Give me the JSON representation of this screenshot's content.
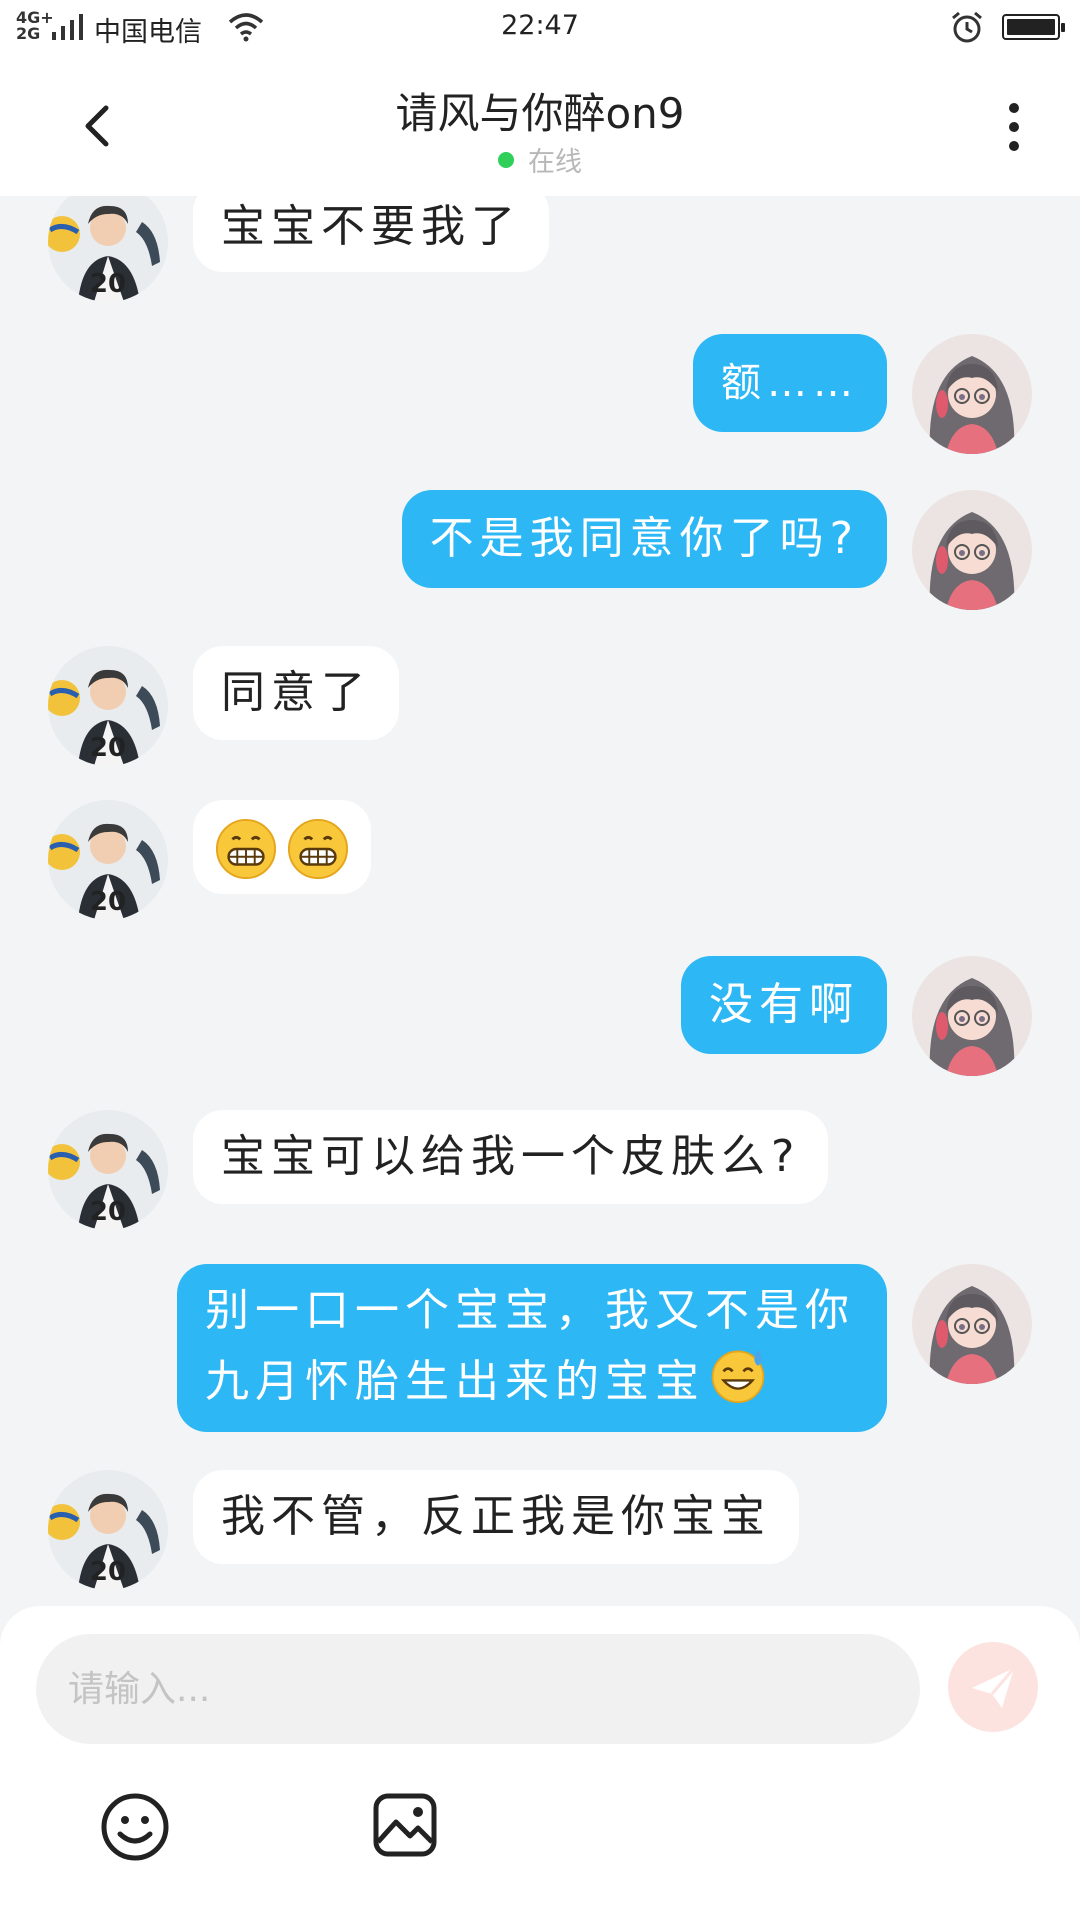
{
  "status_bar": {
    "signal_top": "4G+",
    "signal_bottom": "2G",
    "carrier": "中国电信",
    "time": "22:47"
  },
  "header": {
    "title": "请风与你醉on9",
    "status": "在线"
  },
  "messages": [
    {
      "side": "in",
      "text": "宝宝不要我了"
    },
    {
      "side": "out",
      "text": "额……"
    },
    {
      "side": "out",
      "text": "不是我同意你了吗?"
    },
    {
      "side": "in",
      "text": "同意了"
    },
    {
      "side": "in",
      "emoji": [
        "grinning-face",
        "grinning-face"
      ]
    },
    {
      "side": "out",
      "text": "没有啊"
    },
    {
      "side": "in",
      "text": "宝宝可以给我一个皮肤么?"
    },
    {
      "side": "out",
      "text": "别一口一个宝宝，我又不是你九月怀胎生出来的宝宝",
      "emoji": "sweat-smile-face"
    },
    {
      "side": "in",
      "text": "我不管，反正我是你宝宝"
    }
  ],
  "input": {
    "placeholder": "请输入..."
  },
  "icons": {
    "back": "back-arrow-icon",
    "more": "more-vertical-icon",
    "send": "send-icon",
    "emoji": "emoji-icon",
    "image": "image-icon"
  },
  "colors": {
    "outgoing_bubble": "#2db7f5",
    "incoming_bubble": "#ffffff",
    "background": "#f3f4f6",
    "online_dot": "#2fcf5a",
    "send_button": "#fde3df"
  }
}
